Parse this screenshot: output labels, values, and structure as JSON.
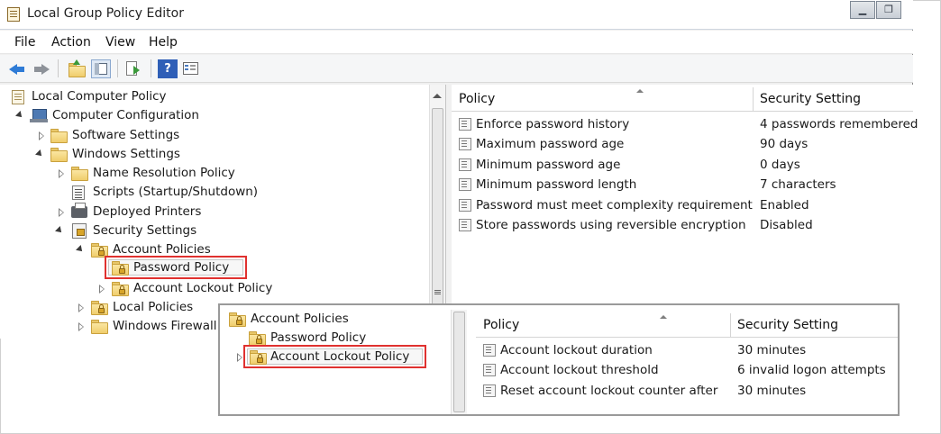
{
  "window": {
    "title": "Local Group Policy Editor",
    "minimize_glyph": "▁",
    "restore_glyph": "❐"
  },
  "menu": {
    "items": [
      "File",
      "Action",
      "View",
      "Help"
    ]
  },
  "toolbar": {
    "icons": [
      "back-arrow-icon",
      "forward-arrow-icon",
      "up-folder-icon",
      "show-hide-tree-icon",
      "export-list-icon",
      "help-icon",
      "properties-icon"
    ],
    "help_glyph": "?"
  },
  "tree": {
    "items": [
      {
        "label": "Local Computer Policy",
        "icon": "policy-icon"
      },
      {
        "label": "Computer Configuration",
        "icon": "computer-icon"
      },
      {
        "label": "Software Settings",
        "icon": "folder-icon"
      },
      {
        "label": "Windows Settings",
        "icon": "folder-icon"
      },
      {
        "label": "Name Resolution Policy",
        "icon": "folder-icon"
      },
      {
        "label": "Scripts (Startup/Shutdown)",
        "icon": "script-icon"
      },
      {
        "label": "Deployed Printers",
        "icon": "printer-icon"
      },
      {
        "label": "Security Settings",
        "icon": "security-icon"
      },
      {
        "label": "Account Policies",
        "icon": "locked-folder-icon"
      },
      {
        "label": "Password Policy",
        "icon": "locked-folder-icon",
        "selected": true
      },
      {
        "label": "Account Lockout Policy",
        "icon": "locked-folder-icon"
      },
      {
        "label": "Local Policies",
        "icon": "locked-folder-icon"
      },
      {
        "label": "Windows Firewall",
        "icon": "folder-icon"
      }
    ]
  },
  "list": {
    "columns": [
      "Policy",
      "Security Setting"
    ],
    "rows": [
      {
        "policy": "Enforce password history",
        "setting": "4 passwords remembered"
      },
      {
        "policy": "Maximum password age",
        "setting": "90 days"
      },
      {
        "policy": "Minimum password age",
        "setting": "0 days"
      },
      {
        "policy": "Minimum password length",
        "setting": "7 characters"
      },
      {
        "policy": "Password must meet complexity requirement",
        "setting": "Enabled"
      },
      {
        "policy": "Store passwords using reversible encryption",
        "setting": "Disabled"
      }
    ]
  },
  "inset": {
    "tree": [
      {
        "label": "Account Policies"
      },
      {
        "label": "Password Policy"
      },
      {
        "label": "Account Lockout Policy",
        "selected": true
      }
    ],
    "columns": [
      "Policy",
      "Security Setting"
    ],
    "rows": [
      {
        "policy": "Account lockout duration",
        "setting": "30 minutes"
      },
      {
        "policy": "Account lockout threshold",
        "setting": "6 invalid logon attempts"
      },
      {
        "policy": "Reset account lockout counter after",
        "setting": "30 minutes"
      }
    ]
  },
  "colors": {
    "highlight_border": "#e0312f",
    "back_arrow": "#2e7bd6"
  }
}
